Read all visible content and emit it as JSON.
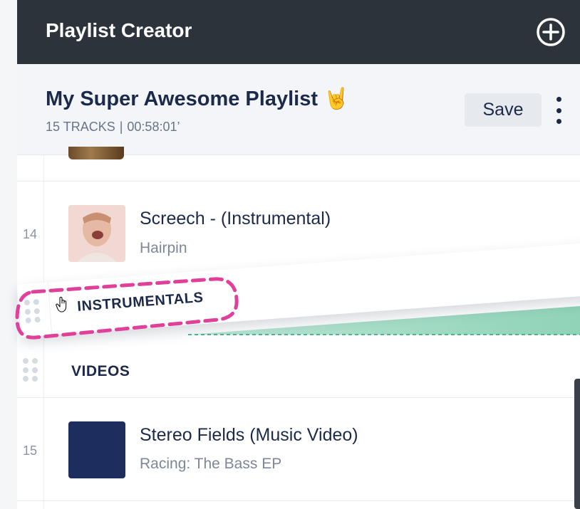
{
  "app": {
    "title": "Playlist Creator",
    "add_icon": "plus-circle-icon"
  },
  "playlist": {
    "title": "My Super Awesome Playlist",
    "emoji": "🤘",
    "track_count": "15 TRACKS",
    "separator": "|",
    "duration": "00:58:01’",
    "save_label": "Save",
    "more_icon": "vertical-ellipsis-icon"
  },
  "tracks": [
    {
      "number": "14",
      "title": "Screech - (Instrumental)",
      "artist": "Hairpin",
      "art": "photo"
    },
    {
      "number": "15",
      "title": "Stereo Fields (Music Video)",
      "artist": "Racing: The Bass EP",
      "art_color": "#1d2d5e"
    }
  ],
  "sections": {
    "dragging": "INSTRUMENTALS",
    "videos": "VIDEOS"
  },
  "colors": {
    "header_bg": "#2d333b",
    "drop_indicator": "#1fa37a",
    "highlight": "#e0409a"
  }
}
